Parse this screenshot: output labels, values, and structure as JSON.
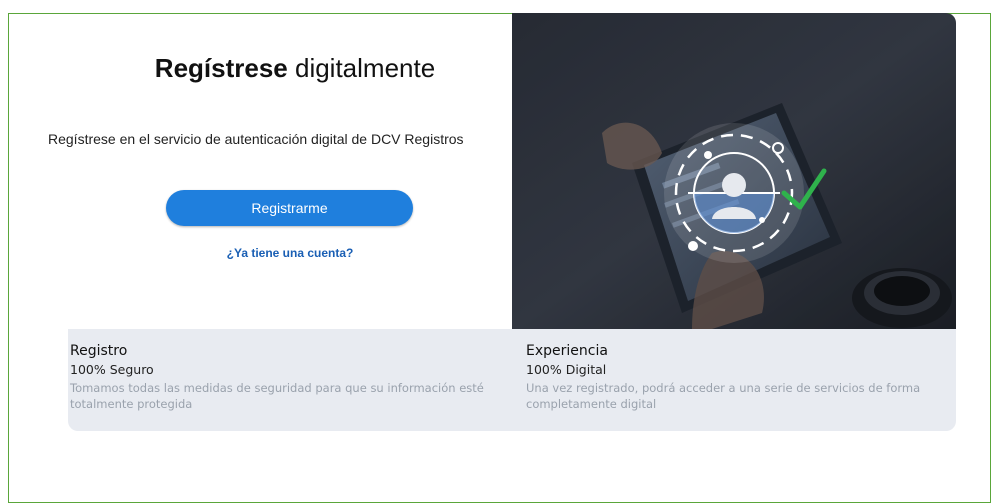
{
  "header": {
    "title_bold": "Regístrese",
    "title_rest": " digitalmente",
    "subtitle": "Regístrese en el servicio de autenticación digital de DCV Registros"
  },
  "actions": {
    "register_label": "Registrarme",
    "login_link": "¿Ya tiene una cuenta?"
  },
  "features": [
    {
      "title": "Registro",
      "subtitle": "100% Seguro",
      "description": "Tomamos todas las medidas de seguridad para que su información esté totalmente protegida"
    },
    {
      "title": "Experiencia",
      "subtitle": "100% Digital",
      "description": "Una vez registrado, podrá acceder a una serie de servicios de forma completamente digital"
    }
  ],
  "colors": {
    "primary": "#1f7fdd",
    "link": "#1a5fb4",
    "info_bg": "#e8ebf1",
    "frame_border": "#5aa63a",
    "check": "#2fb24c"
  },
  "hero": {
    "icons": [
      "face-id-icon",
      "checkmark-icon"
    ]
  }
}
